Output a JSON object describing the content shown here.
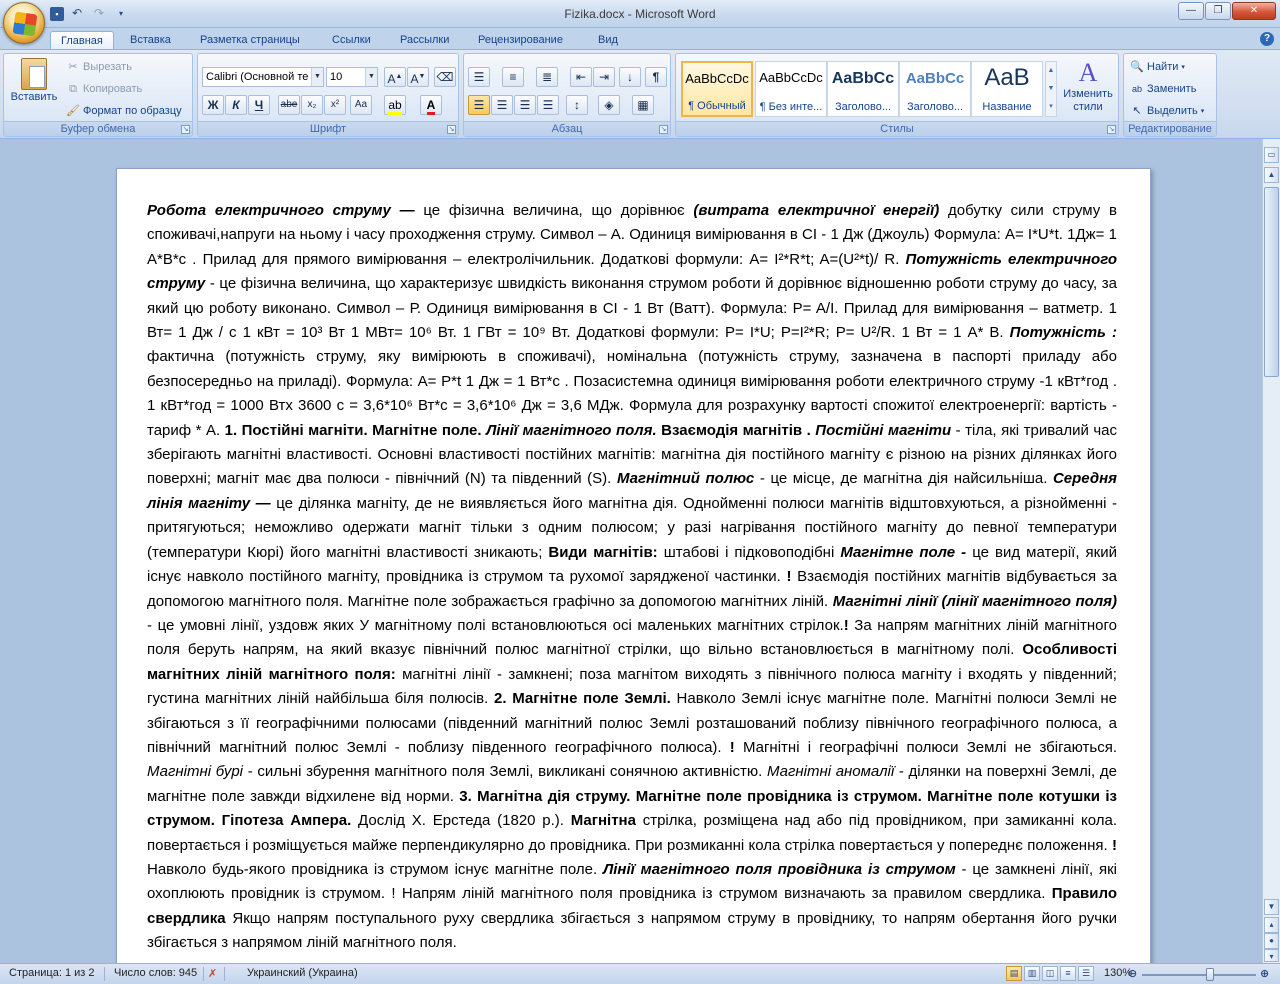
{
  "window": {
    "title": "Fizika.docx - Microsoft Word"
  },
  "tabs": [
    "Главная",
    "Вставка",
    "Разметка страницы",
    "Ссылки",
    "Рассылки",
    "Рецензирование",
    "Вид"
  ],
  "clipboard": {
    "paste": "Вставить",
    "cut": "Вырезать",
    "copy": "Копировать",
    "format": "Формат по образцу",
    "label": "Буфер обмена"
  },
  "font": {
    "name": "Calibri (Основной те",
    "size": "10",
    "label": "Шрифт"
  },
  "paragraph": {
    "label": "Абзац"
  },
  "styles": {
    "label": "Стилы",
    "items": [
      {
        "sample": "AaBbCcDc",
        "name": "¶ Обычный"
      },
      {
        "sample": "AaBbCcDc",
        "name": "¶ Без инте..."
      },
      {
        "sample": "AaBbCc",
        "name": "Заголово..."
      },
      {
        "sample": "AaBbCc",
        "name": "Заголово..."
      },
      {
        "sample": "AaB",
        "name": "Название"
      }
    ],
    "change": "Изменить стили"
  },
  "editing": {
    "find": "Найти",
    "replace": "Заменить",
    "select": "Выделить",
    "label": "Редактирование"
  },
  "document": {
    "p1_a": "Робота електричного струму —",
    "p1_b": " це фізична величина, що дорівнює ",
    "p1_c": "(витрата електричної енергії)",
    "p1_d": " добутку сили струму в споживачі,напруги на ньому і часу проходження струму. Символ – А. Одиниця вимірювання в СІ - 1 Дж (Джоуль) Формула: A= I*U*t. 1Дж= 1 А*В*с . Прилад для прямого вимірювання – електролічильник. Додаткові формули: A= I²*R*t; A=(U²*t)/ R. ",
    "p2_a": "Потужність електричного струму",
    "p2_b": " - це фізична величина, що характеризує швидкість виконання струмом роботи й дорівнює відношенню роботи струму до часу, за який цю роботу виконано. Символ – Р. Одиниця вимірювання в СІ - 1 Вт (Ватт). Формула: P= A/I. Прилад для вимірювання – ватметр. 1 Вт= 1 Дж / с 1 кВт = 10³ Вт 1 МВт= 10⁶ Вт. 1 ГВт = 10⁹ Вт. Додаткові формули: P= I*U; P=I²*R; P= U²/R. 1 Вт = 1 А* В. ",
    "p3_a": "Потужність :",
    "p3_b": " фактична (потужність струму, яку вимірюють в споживачі), номінальна (потужність струму, зазначена в паспорті приладу або безпосередньо на приладі). Формула: A= P*t 1 Дж = 1 Вт*с . Позасистемна одиниця вимірювання роботи електричного струму -1 кВт*год . 1 кВт*год = 1000 Втх 3600 с = 3,6*10⁶ Вт*с = 3,6*10⁶ Дж = 3,6 МДж. Формула для розрахунку вартості спожитої електроенергії: вартість - тариф * А. ",
    "p4_a": "1. Постійні магніти. Магнітне поле. ",
    "p4_b": "Лінії магнітного поля.",
    "p4_c": " Взаємодія магнітів . ",
    "p4_d": "Постійні магніти",
    "p4_e": " - тіла, які тривалий час зберігають магнітні властивості. Основні властивості постійних магнітів: магнітна дія постійного магніту є різною на різних ділянках його поверхні; магніт має два полюси - північний (N) та південний (S). ",
    "p5_a": "Магнітний полюс",
    "p5_b": " - це місце, де магнітна дія найсильніша. ",
    "p5_c": "Середня лінія магніту —",
    "p5_d": " це ділянка магніту, де не виявляється його магнітна дія. Однойменні полюси магнітів відштовхуються, а різнойменні - притягуються; неможливо одержати магніт тільки з одним полюсом; у разі нагрівання постійного магніту до певної температури (температури Кюрі) його магнітні властивості зникають; ",
    "p6_a": "Види магнітів:",
    "p6_b": " штабові і підковоподібні ",
    "p6_c": "Магнітне поле -",
    "p6_d": " це вид матерії, який існує навколо постійного магніту, провідника із струмом та рухомої зарядженої частинки. ",
    "p6_e": "!",
    "p6_f": " Взаємодія постійних магнітів відбувається за допомогою магнітного поля. Магнітне поле зображається графічно за допомогою магнітних ліній. ",
    "p7_a": "Магнітні лінії (лінії магнітного поля)",
    "p7_b": " - це умовні лінії, уздовж яких У магнітному полі встановлюються осі маленьких магнітних стрілок.",
    "p7_c": "!",
    "p7_d": "          За напрям магнітних ліній магнітного поля беруть напрям, на який вказує північний полюс магнітної стрілки, що вільно встановлюється в магнітному полі. ",
    "p8_a": "Особливості магнітних ліній магнітного поля:",
    "p8_b": " магнітні лінії - замкнені; поза магнітом виходять з північного полюса магніту і входять у південний; густина магнітних ліній найбільша біля полюсів. ",
    "p8_c": "2. Магнітне поле Землі.",
    "p8_d": " Навколо Землі існує магнітне поле. Магнітні полюси Землі не збігаються з її географічними полюсами (південний магнітний полюс Землі розташований поблизу північного географічного полюса, а північний магнітний полюс Землі - поблизу південного географічного полюса). ",
    "p8_e": "!",
    "p8_f": " Магнітні і географічні полюси Землі не збігаються. ",
    "p9_a": "Магнітні бурі",
    "p9_b": " - сильні збурення магнітного поля Землі, викликані сонячною активністю. ",
    "p9_c": "Магнітні аномалії",
    "p9_d": " - ділянки на поверхні Землі, де магнітне поле завжди відхилене від норми. ",
    "p9_e": "3. Магнітна дія струму. Магнітне поле провідника із струмом. Магнітне поле котушки із струмом. Гіпотеза Ампера.",
    "p9_f": " Дослід Х. Ерстеда (1820 р.). ",
    "p9_g": "Магнітна",
    "p9_h": " стрілка, розміщена над або під провідником, при замиканні кола. повертається і розміщується майже перпендикулярно до провідника. При розмиканні кола стрілка повертається у попереднє положення. ",
    "p9_i": "!",
    "p9_j": " Навколо будь-якого провідника із струмом існує магнітне поле. ",
    "p10_a": "Лінії магнітного поля провідника із струмом",
    "p10_b": " - це замкнені лінії, які охоплюють провідник із струмом. ! Напрям ліній магнітного поля провідника із струмом визначають за правилом свердлика. ",
    "p10_c": "Правило свердлика",
    "p10_d": " Якщо напрям поступального руху свердлика збігається з напрямом струму в провіднику, то напрям обертання його ручки збігається з напрямом ліній магнітного поля."
  },
  "status": {
    "page": "Страница: 1 из 2",
    "words": "Число слов: 945",
    "language": "Украинский (Украина)",
    "zoom": "130%"
  }
}
